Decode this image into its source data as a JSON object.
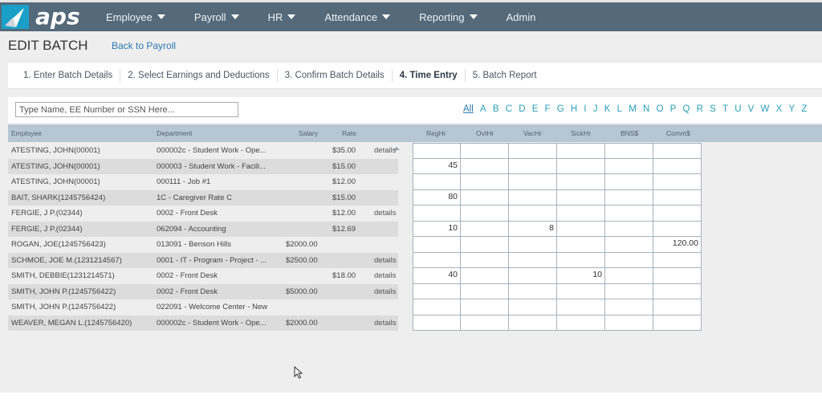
{
  "app": {
    "logo_text": "aps",
    "brand_color": "#1aa0c8",
    "navbar_color": "#546979"
  },
  "nav": {
    "items": [
      {
        "label": "Employee",
        "has_dropdown": true
      },
      {
        "label": "Payroll",
        "has_dropdown": true
      },
      {
        "label": "HR",
        "has_dropdown": true
      },
      {
        "label": "Attendance",
        "has_dropdown": true
      },
      {
        "label": "Reporting",
        "has_dropdown": true
      },
      {
        "label": "Admin",
        "has_dropdown": false
      }
    ]
  },
  "page": {
    "title": "EDIT BATCH",
    "back_link": "Back to Payroll"
  },
  "steps": [
    {
      "label": "1. Enter Batch Details",
      "active": false
    },
    {
      "label": "2. Select Earnings and Deductions",
      "active": false
    },
    {
      "label": "3. Confirm Batch Details",
      "active": false
    },
    {
      "label": "4. Time Entry",
      "active": true
    },
    {
      "label": "5. Batch Report",
      "active": false
    }
  ],
  "filter": {
    "search_placeholder": "Type Name, EE Number or SSN Here...",
    "search_value": "",
    "alphabet": [
      "All",
      "A",
      "B",
      "C",
      "D",
      "E",
      "F",
      "G",
      "H",
      "I",
      "J",
      "K",
      "L",
      "M",
      "N",
      "O",
      "P",
      "Q",
      "R",
      "S",
      "T",
      "U",
      "V",
      "W",
      "X",
      "Y",
      "Z"
    ],
    "selected_letter": "All"
  },
  "columns": {
    "employee": "Employee",
    "department": "Department",
    "salary": "Salary",
    "rate": "Rate",
    "entry": [
      "RegHr",
      "OvtHr",
      "VacHr",
      "SickHr",
      "BNS$",
      "Comm$"
    ]
  },
  "rows": [
    {
      "employee": "ATESTING, JOHN(00001)",
      "department": "000002c - Student Work - Ope...",
      "salary": "",
      "rate": "$35.00",
      "details": "details",
      "entries": [
        "",
        "",
        "",
        "",
        "",
        ""
      ]
    },
    {
      "employee": "ATESTING, JOHN(00001)",
      "department": "000003 - Student Work - Facili...",
      "salary": "",
      "rate": "$15.00",
      "details": "",
      "entries": [
        "45",
        "",
        "",
        "",
        "",
        ""
      ]
    },
    {
      "employee": "ATESTING, JOHN(00001)",
      "department": "000111 - Job #1",
      "salary": "",
      "rate": "$12.00",
      "details": "",
      "entries": [
        "",
        "",
        "",
        "",
        "",
        ""
      ]
    },
    {
      "employee": "BAIT, SHARK(1245756424)",
      "department": "1C - Caregiver Rate C",
      "salary": "",
      "rate": "$15.00",
      "details": "",
      "entries": [
        "80",
        "",
        "",
        "",
        "",
        ""
      ]
    },
    {
      "employee": "FERGIE, J P.(02344)",
      "department": "0002 - Front Desk",
      "salary": "",
      "rate": "$12.00",
      "details": "details",
      "entries": [
        "",
        "",
        "",
        "",
        "",
        ""
      ]
    },
    {
      "employee": "FERGIE, J P.(02344)",
      "department": "062094 - Accounting",
      "salary": "",
      "rate": "$12.69",
      "details": "",
      "entries": [
        "10",
        "",
        "8",
        "",
        "",
        ""
      ]
    },
    {
      "employee": "ROGAN, JOE(1245756423)",
      "department": "013091 - Benson Hills",
      "salary": "$2000.00",
      "rate": "",
      "details": "",
      "entries": [
        "",
        "",
        "",
        "",
        "",
        "120.00"
      ]
    },
    {
      "employee": "SCHMOE, JOE M.(1231214567)",
      "department": "0001 - IT - Program - Project - ...",
      "salary": "$2500.00",
      "rate": "",
      "details": "details",
      "entries": [
        "",
        "",
        "",
        "",
        "",
        ""
      ]
    },
    {
      "employee": "SMITH, DEBBIE(1231214571)",
      "department": "0002 - Front Desk",
      "salary": "",
      "rate": "$18.00",
      "details": "details",
      "entries": [
        "40",
        "",
        "",
        "10",
        "",
        ""
      ]
    },
    {
      "employee": "SMITH, JOHN P.(1245756422)",
      "department": "0002 - Front Desk",
      "salary": "$5000.00",
      "rate": "",
      "details": "details",
      "entries": [
        "",
        "",
        "",
        "",
        "",
        ""
      ]
    },
    {
      "employee": "SMITH, JOHN P.(1245756422)",
      "department": "022091 - Welcome Center - New",
      "salary": "",
      "rate": "",
      "details": "",
      "entries": [
        "",
        "",
        "",
        "",
        "",
        ""
      ]
    },
    {
      "employee": "WEAVER, MEGAN L.(1245756420)",
      "department": "000002c - Student Work - Ope...",
      "salary": "$2000.00",
      "rate": "",
      "details": "details",
      "entries": [
        "",
        "",
        "",
        "",
        "",
        ""
      ]
    }
  ]
}
